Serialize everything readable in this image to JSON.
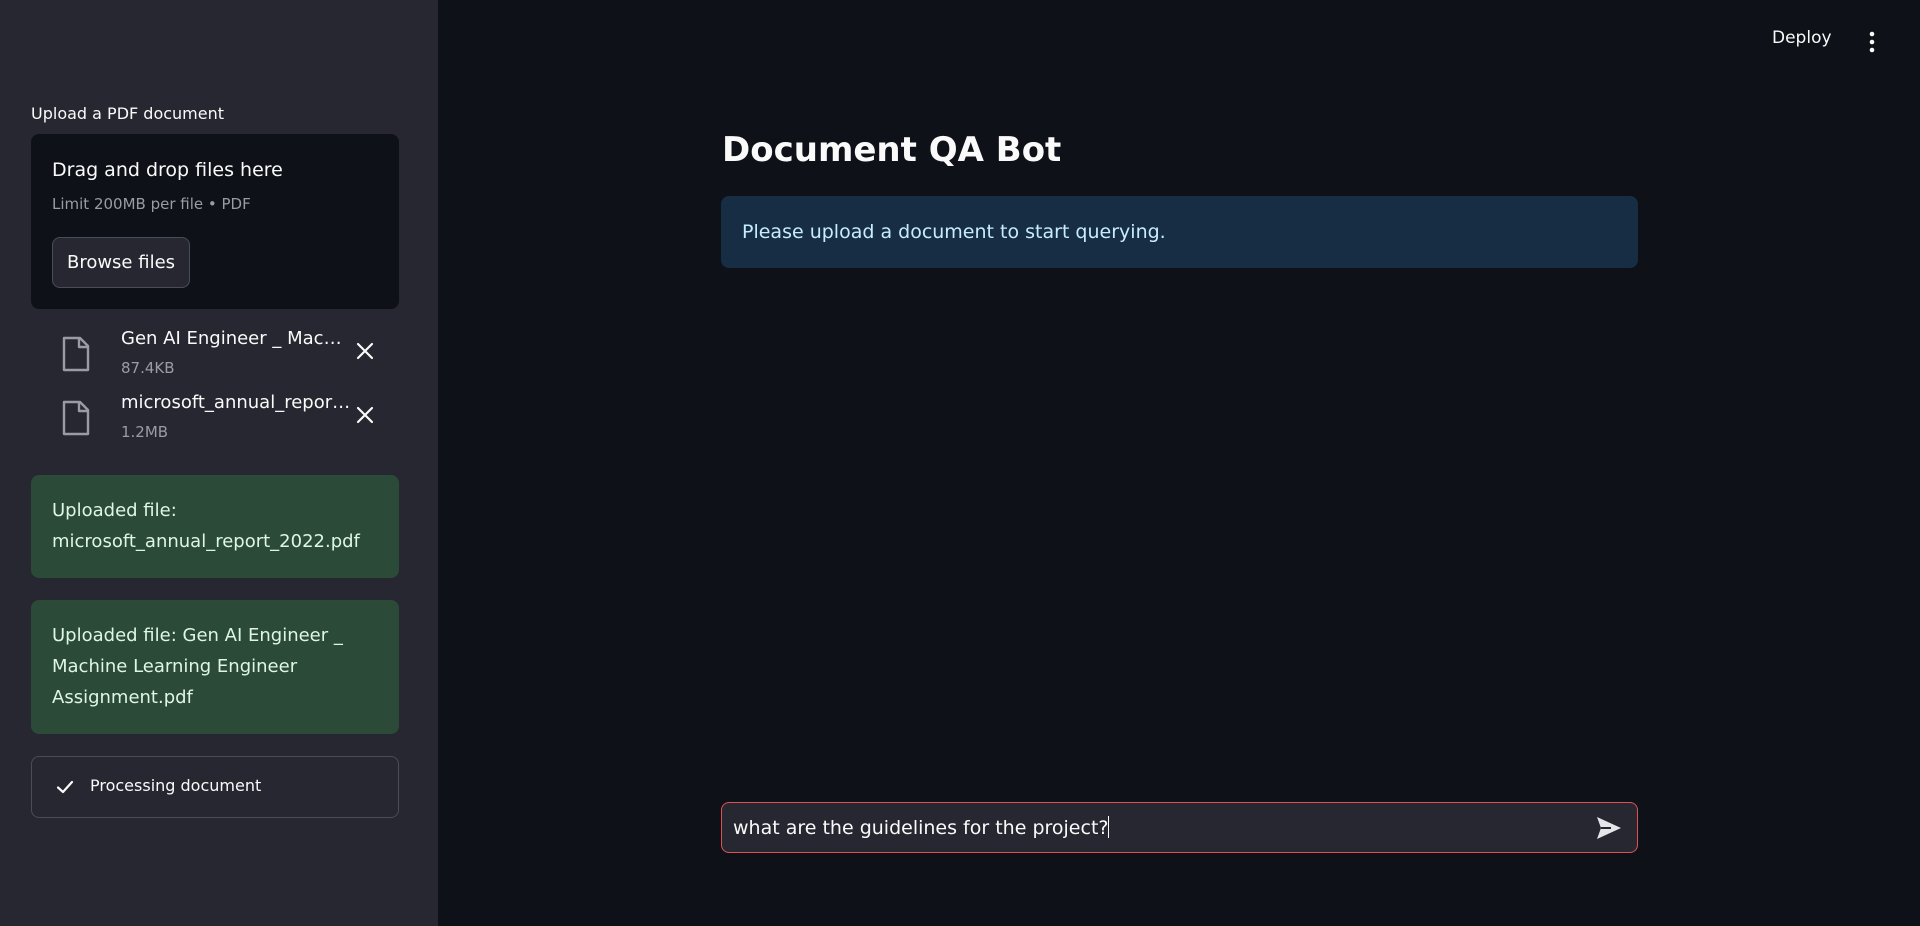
{
  "sidebar": {
    "uploader_label": "Upload a PDF document",
    "dropzone": {
      "title": "Drag and drop files here",
      "limit": "Limit 200MB per file • PDF",
      "browse_label": "Browse files"
    },
    "files": [
      {
        "name": "Gen AI Engineer _ Machine Learning Engineer Assignment.pdf",
        "size": "87.4KB",
        "icon": "file-icon"
      },
      {
        "name": "microsoft_annual_report_2022.pdf",
        "size": "1.2MB",
        "icon": "file-icon"
      }
    ],
    "messages": [
      "Uploaded file: microsoft_annual_report_2022.pdf",
      "Uploaded file: Gen AI Engineer _ Machine Learning Engineer Assignment.pdf"
    ],
    "status": {
      "label": "Processing document",
      "icon": "check-icon"
    }
  },
  "header": {
    "deploy_label": "Deploy",
    "menu_icon": "more-vertical-icon"
  },
  "main": {
    "title": "Document QA Bot",
    "info": "Please upload a document to start querying.",
    "chat_input": {
      "value": "what are the guidelines for the project?",
      "send_icon": "send-icon"
    }
  },
  "colors": {
    "background": "#0e1117",
    "sidebar": "#262730",
    "success_bg": "#2b4a38",
    "info_bg": "#172d43",
    "input_border_focus": "#e05252"
  }
}
